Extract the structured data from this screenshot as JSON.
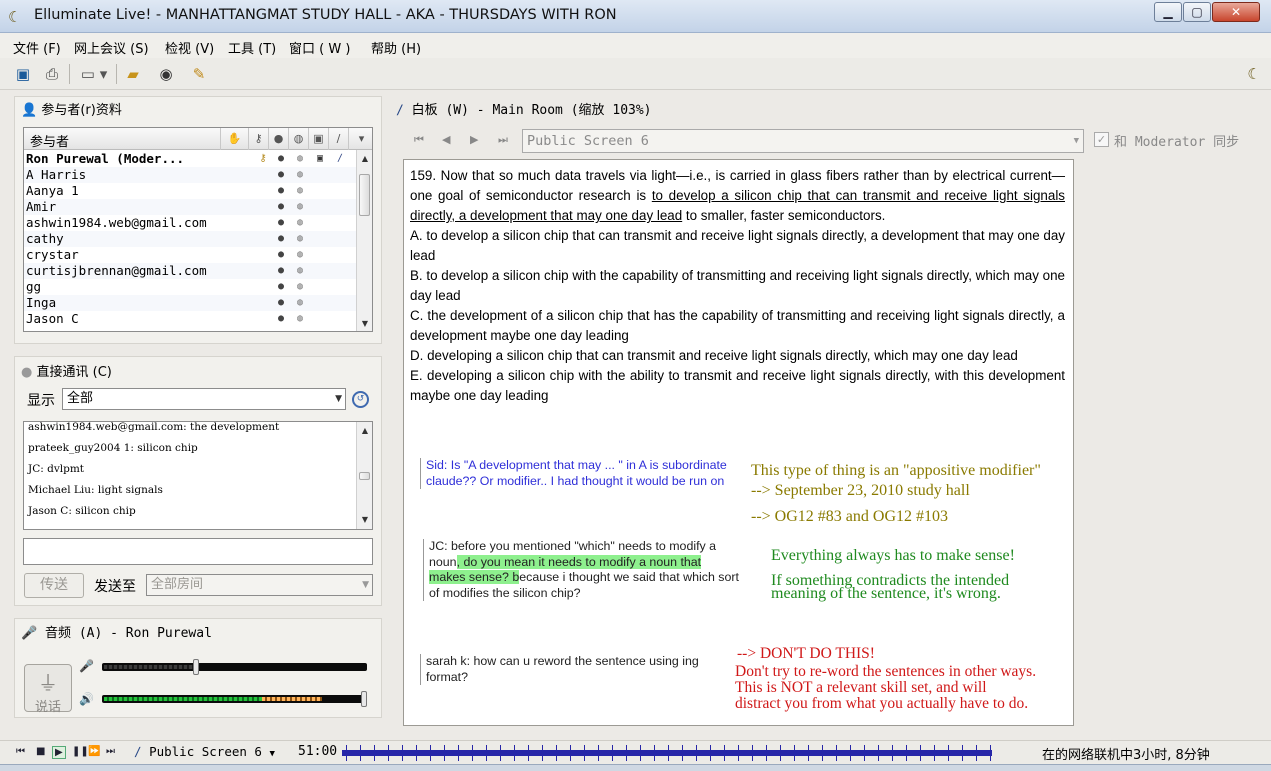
{
  "window": {
    "title": "Elluminate Live! - MANHATTANGMAT STUDY HALL - AKA - THURSDAYS WITH RON",
    "min": "▭",
    "max": "▢",
    "close": "✕"
  },
  "menu": [
    "文件 (F)",
    "网上会议 (S)",
    "检视 (V)",
    "工具 (T)",
    "窗口 ( W )",
    "帮助 (H)"
  ],
  "participants": {
    "heading": "参与者(r)资料",
    "column_label": "参与者",
    "rows": [
      {
        "name": "Ron Purewal (Moder...",
        "bold": true
      },
      {
        "name": "A Harris"
      },
      {
        "name": "Aanya 1"
      },
      {
        "name": "Amir"
      },
      {
        "name": "ashwin1984.web@gmail.com"
      },
      {
        "name": "cathy"
      },
      {
        "name": "crystar"
      },
      {
        "name": "curtisjbrennan@gmail.com"
      },
      {
        "name": "gg"
      },
      {
        "name": "Inga"
      },
      {
        "name": "Jason C"
      }
    ]
  },
  "chat": {
    "heading": "直接通讯 (C)",
    "show_label": "显示",
    "show_value": "全部",
    "messages": [
      "ashwin1984.web@gmail.com: the development",
      "prateek_guy2004 1: silicon chip",
      "JC: dvlpmt",
      "Michael Liu: light signals",
      "Jason C: silicon chip"
    ],
    "input_value": "",
    "send_label": "传送",
    "send_to_label": "发送至",
    "send_to_value": "全部房间"
  },
  "audio": {
    "heading": "音频 (A) - Ron Purewal",
    "talk_label": "说话",
    "mic_level": 0.36,
    "speaker_level": 1.0
  },
  "whiteboard": {
    "heading": "白板 (W) - Main Room (缩放 103%)",
    "screen_name": "Public Screen 6",
    "sync_label": "和 Moderator 同步",
    "question": {
      "stem_a": "159. Now that so much data travels via light—i.e., is carried in glass fibers rather than by electrical current—one goal of semiconductor research is ",
      "stem_underlined": "to develop a silicon chip that can transmit and receive light signals directly, a development that may one day lead",
      "stem_b": " to smaller, faster semiconductors.",
      "choices": [
        "A. to develop a silicon chip that can transmit and receive light signals directly, a development that may one day lead",
        "B. to develop a silicon chip with the capability of transmitting and receiving light signals directly, which may one day lead",
        "C. the development of a silicon chip that has the capability of transmitting and receiving light signals directly, a development maybe one day leading",
        "D. developing a silicon chip that can transmit and receive light signals directly, which may one day lead",
        "E. developing a silicon chip with the ability to transmit and receive light signals directly, with this development maybe one day leading"
      ]
    },
    "notes": {
      "sid": "Sid: Is \"A development that may ... \" in A is subordinate claude?? Or modifier.. I had thought it would be run on",
      "jc_a": "JC: before you mentioned \"which\" needs to modify a noun",
      "jc_hl": ", do you mean it needs to modify a noun that makes sense? b",
      "jc_b": "ecause i thought we said that which sort of modifies the silicon chip?",
      "sarah": "sarah k: how can u reword the sentence using ing format?"
    },
    "annotations": {
      "olive_1": "This type of thing is an \"appositive modifier\"",
      "olive_2": "--> September 23, 2010 study hall",
      "olive_3": "--> OG12 #83 and OG12 #103",
      "green_1": "Everything always has to make sense!",
      "green_2": "If something contradicts the intended",
      "green_3": "meaning of the sentence, it's wrong.",
      "red_1": "--> DON'T DO THIS!",
      "red_2": "Don't try to re-word the sentences in other ways.",
      "red_3": "This is NOT a relevant skill set, and will",
      "red_4": "distract you from what you actually have to do."
    },
    "colors": {
      "olive": "#8a7a00",
      "green": "#1f8a1f",
      "red": "#d01818",
      "note_blue": "#2f2fd8"
    }
  },
  "status": {
    "screen": "Public Screen 6",
    "time": "51:00",
    "online": "在的网络联机中3小时, 8分钟"
  },
  "icons": {
    "save": "💾",
    "print": "🖶",
    "view": "▭",
    "folder": "📂",
    "webcam": "◉",
    "notes": "📝",
    "help": "?"
  }
}
